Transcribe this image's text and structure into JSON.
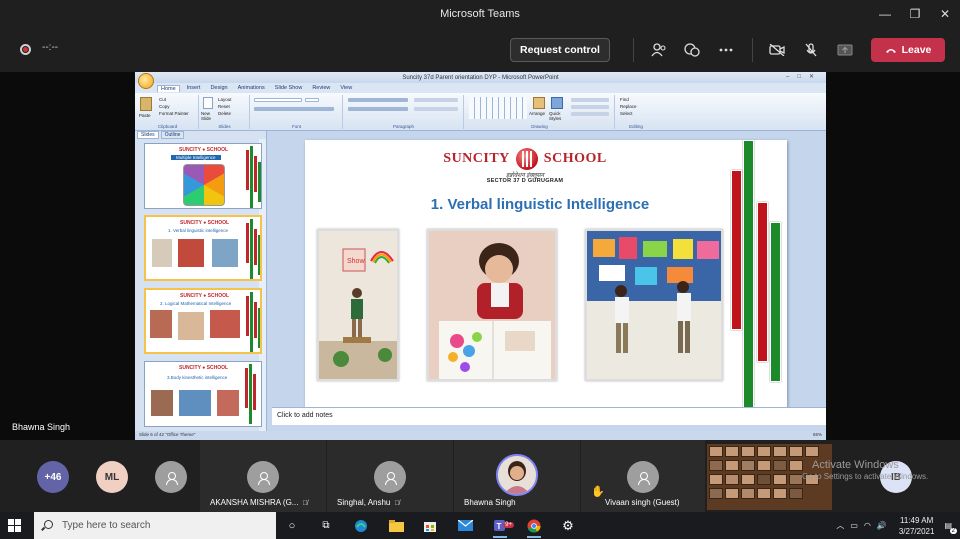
{
  "window": {
    "title": "Microsoft Teams",
    "controls": [
      "—",
      "❐",
      "✕"
    ]
  },
  "meeting_bar": {
    "timer": "--:--",
    "request_control": "Request control",
    "leave": "Leave",
    "icons": [
      "participants-icon",
      "chat-icon",
      "more-icon",
      "camera-off-icon",
      "mic-off-icon",
      "share-icon"
    ]
  },
  "ppt": {
    "title": "Suncity 37d Parent orientation DYP - Microsoft PowerPoint",
    "tabs": [
      "Home",
      "Insert",
      "Design",
      "Animations",
      "Slide Show",
      "Review",
      "View"
    ],
    "ribbon_groups": [
      "Clipboard",
      "Slides",
      "Font",
      "Paragraph",
      "Drawing",
      "Editing"
    ],
    "ribbon_labels": {
      "cut": "Cut",
      "copy": "Copy",
      "format_painter": "Format Painter",
      "paste": "Paste",
      "new_slide": "New Slide",
      "layout": "Layout",
      "reset": "Reset",
      "delete": "Delete",
      "arrange": "Arrange",
      "quick_styles": "Quick Styles",
      "find": "Find",
      "replace": "Replace",
      "select": "Select"
    },
    "panel_tabs": [
      "Slides",
      "Outline"
    ],
    "thumbnails": [
      {
        "num": "",
        "title": "Multiple Intelligence"
      },
      {
        "num": "",
        "title": "1. Verbal linguistic intelligence"
      },
      {
        "num": "",
        "title": "2. Logical Mathematical Intelligence"
      },
      {
        "num": "",
        "title": "3.Body kinesthetic intelligence"
      }
    ],
    "slide": {
      "logo_left": "SUNCITY",
      "logo_right": "SCHOOL",
      "tagline": "इन्नोवेशन इंक्लूसन",
      "sector": "SECTOR 37 D GURUGRAM",
      "heading": "1. Verbal linguistic Intelligence"
    },
    "notes_placeholder": "Click to add notes",
    "status_left": "Slide 6 of 42    \"Office Theme\"",
    "status_right": "65%"
  },
  "speaker": "Bhawna Singh",
  "gallery": {
    "overflow_count": "+46",
    "tiles": [
      {
        "initials": "ML"
      },
      {
        "initials": ""
      },
      {
        "name": "AKANSHA MISHRA (G...",
        "muted": true
      },
      {
        "name": "Singhal, Anshu",
        "muted": true
      },
      {
        "name": "Bhawna Singh",
        "muted": false
      },
      {
        "name": "Vivaan singh (Guest)",
        "muted": false,
        "hand_raised": true
      },
      {
        "initials": "IB"
      }
    ],
    "watermark_line1": "Activate Windows",
    "watermark_line2": "Go to Settings to activate Windows."
  },
  "taskbar": {
    "search_placeholder": "Type here to search",
    "teams_badge": "9+",
    "time": "11:49 AM",
    "date": "3/27/2021",
    "notification_count": "2",
    "colors": {
      "leave": "#c4314b",
      "teams": "#5b5fc7",
      "overflow": "#6264a7"
    }
  }
}
